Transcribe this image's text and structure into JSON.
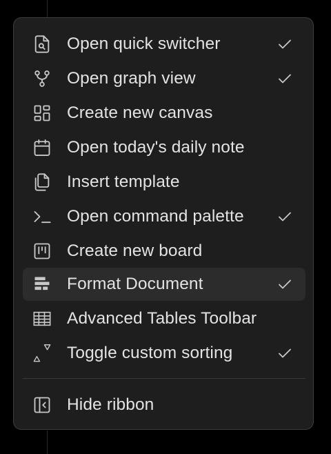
{
  "menu": {
    "items": [
      {
        "label": "Open quick switcher",
        "icon": "file-search-icon",
        "checked": true
      },
      {
        "label": "Open graph view",
        "icon": "git-fork-icon",
        "checked": true
      },
      {
        "label": "Create new canvas",
        "icon": "layout-dashboard-icon",
        "checked": false
      },
      {
        "label": "Open today's daily note",
        "icon": "calendar-icon",
        "checked": false
      },
      {
        "label": "Insert template",
        "icon": "copy-icon",
        "checked": false
      },
      {
        "label": "Open command palette",
        "icon": "terminal-icon",
        "checked": true
      },
      {
        "label": "Create new board",
        "icon": "kanban-icon",
        "checked": false
      },
      {
        "label": "Format Document",
        "icon": "align-left-bars-icon",
        "checked": true,
        "highlighted": true
      },
      {
        "label": "Advanced Tables Toolbar",
        "icon": "table-grid-icon",
        "checked": false
      },
      {
        "label": "Toggle custom sorting",
        "icon": "sort-triangles-icon",
        "checked": true
      }
    ],
    "footer": {
      "label": "Hide ribbon",
      "icon": "panel-left-close-icon"
    }
  },
  "colors": {
    "background": "#000000",
    "menu_bg": "#1e1e1e",
    "menu_border": "#3c3c3c",
    "text": "#e3e3e3",
    "icon": "#c8c8c8",
    "highlight_bg": "#2c2c2c"
  }
}
